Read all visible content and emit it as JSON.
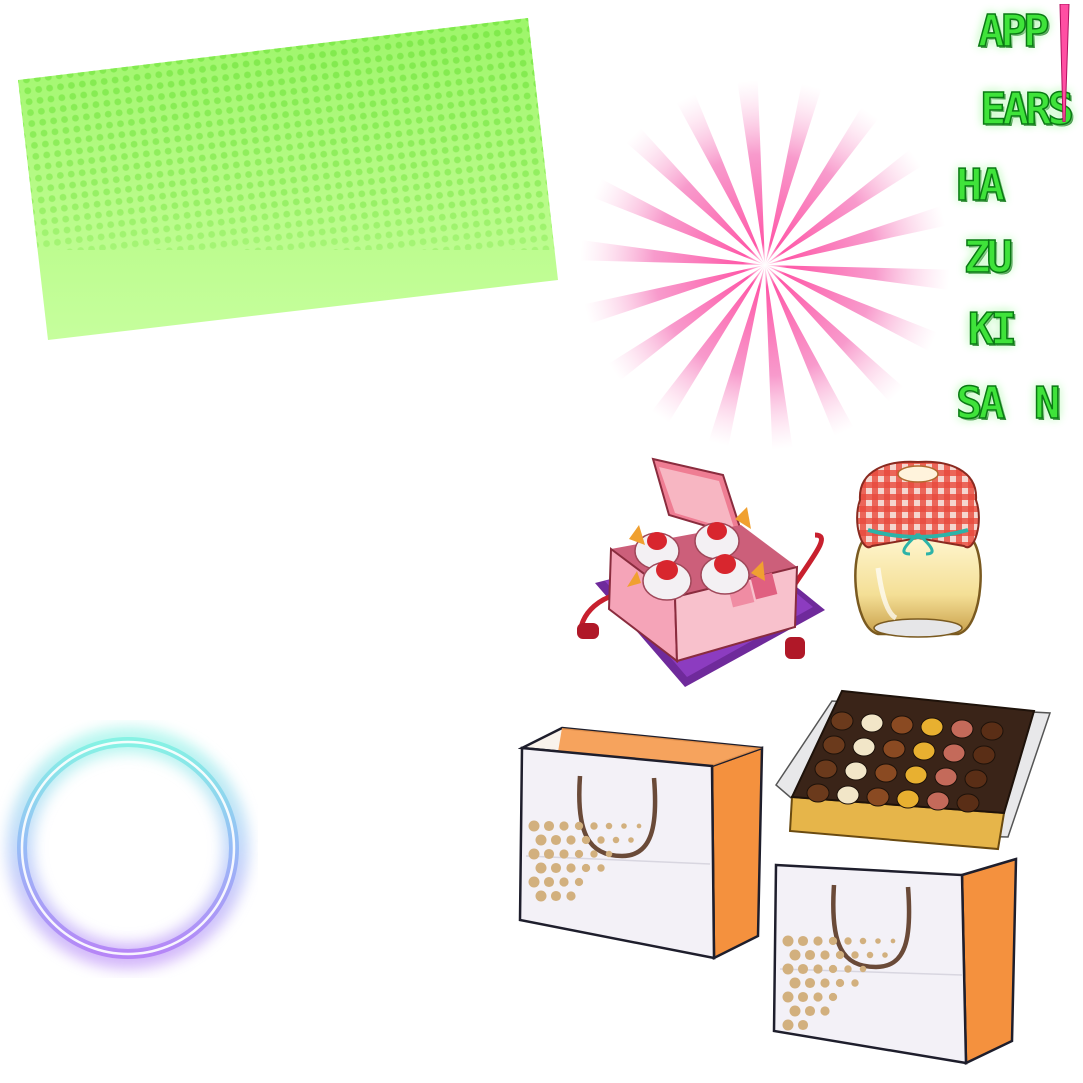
{
  "title": {
    "lines": [
      "APP",
      "EARS",
      "HA",
      "ZU",
      "KI",
      "SA",
      "N"
    ],
    "excl_color": "#ff4fa3"
  },
  "colors": {
    "banner_green": "#8ef55a",
    "banner_green_light": "#c8ffa0",
    "burst_pink": "#f25aa8",
    "title_green": "#3fe33a",
    "ring_cyan": "#7cf1e2",
    "ring_violet": "#a57cf5",
    "bag_orange": "#f4913e",
    "bag_white": "#f5f3f8",
    "bag_dot": "#d2b07e",
    "box_pink": "#f4a3b3",
    "jar_cloth": "#e84a3c",
    "chocolate_gold": "#e6b54a"
  },
  "items": [
    {
      "id": "strawberry-daifuku-box",
      "icon": "gift-box-icon"
    },
    {
      "id": "pudding-jar",
      "icon": "jar-icon"
    },
    {
      "id": "chocolate-box",
      "icon": "chocolate-box-icon"
    },
    {
      "id": "shopping-bag-left",
      "icon": "shopping-bag-icon"
    },
    {
      "id": "shopping-bag-right",
      "icon": "shopping-bag-icon"
    }
  ]
}
